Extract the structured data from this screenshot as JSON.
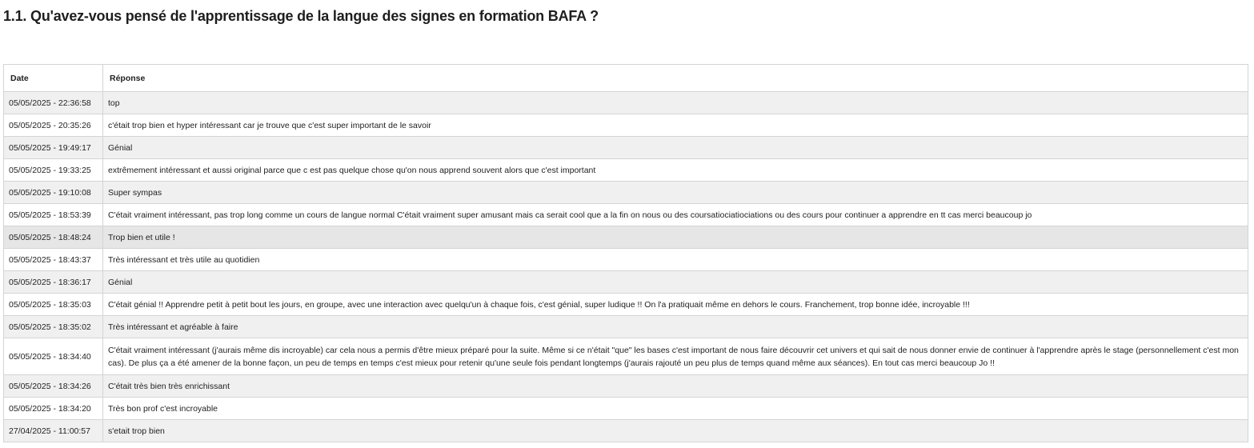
{
  "question": {
    "title": "1.1. Qu'avez-vous pensé de l'apprentissage de la langue des signes en formation BAFA ?"
  },
  "table": {
    "headers": {
      "date": "Date",
      "response": "Réponse"
    },
    "rows": [
      {
        "date": "05/05/2025 - 22:36:58",
        "response": "top"
      },
      {
        "date": "05/05/2025 - 20:35:26",
        "response": "c'était trop bien et hyper intéressant car je trouve que c'est super important de le savoir"
      },
      {
        "date": "05/05/2025 - 19:49:17",
        "response": "Génial"
      },
      {
        "date": "05/05/2025 - 19:33:25",
        "response": "extrêmement intéressant et aussi original parce que c est pas quelque chose qu'on nous apprend souvent alors que c'est important"
      },
      {
        "date": "05/05/2025 - 19:10:08",
        "response": "Super sympas"
      },
      {
        "date": "05/05/2025 - 18:53:39",
        "response": "C'était vraiment intéressant, pas trop long comme un cours de langue normal C'était vraiment super amusant mais ca serait cool que a la fin on nous ou des coursatiociatiociations ou des cours pour continuer a apprendre en tt cas merci beaucoup jo"
      },
      {
        "date": "05/05/2025 - 18:48:24",
        "response": "Trop bien et utile !"
      },
      {
        "date": "05/05/2025 - 18:43:37",
        "response": "Très intéressant et très utile au quotidien"
      },
      {
        "date": "05/05/2025 - 18:36:17",
        "response": "Génial"
      },
      {
        "date": "05/05/2025 - 18:35:03",
        "response": "C'était génial !! Apprendre petit à petit bout les jours, en groupe, avec une interaction avec quelqu'un à chaque fois, c'est génial, super ludique !! On l'a pratiquait même en dehors le cours. Franchement, trop bonne idée, incroyable !!!"
      },
      {
        "date": "05/05/2025 - 18:35:02",
        "response": "Très intéressant et agréable à faire"
      },
      {
        "date": "05/05/2025 - 18:34:40",
        "response": "C'était vraiment intéressant (j'aurais même dis incroyable) car cela nous a permis d'être mieux préparé pour la suite. Même si ce n'était \"que\" les bases c'est important de nous faire découvrir cet univers et qui sait de nous donner envie de continuer à l'apprendre après le stage (personnellement c'est mon cas). De plus ça a été amener de la bonne façon, un peu de temps en temps c'est mieux pour retenir qu'une seule fois pendant longtemps (j'aurais rajouté un peu plus de temps quand même aux séances). En tout cas merci beaucoup Jo !!"
      },
      {
        "date": "05/05/2025 - 18:34:26",
        "response": "C'était très bien très enrichissant"
      },
      {
        "date": "05/05/2025 - 18:34:20",
        "response": "Très bon prof c'est incroyable"
      },
      {
        "date": "27/04/2025 - 11:00:57",
        "response": "s'etait trop bien"
      }
    ]
  }
}
